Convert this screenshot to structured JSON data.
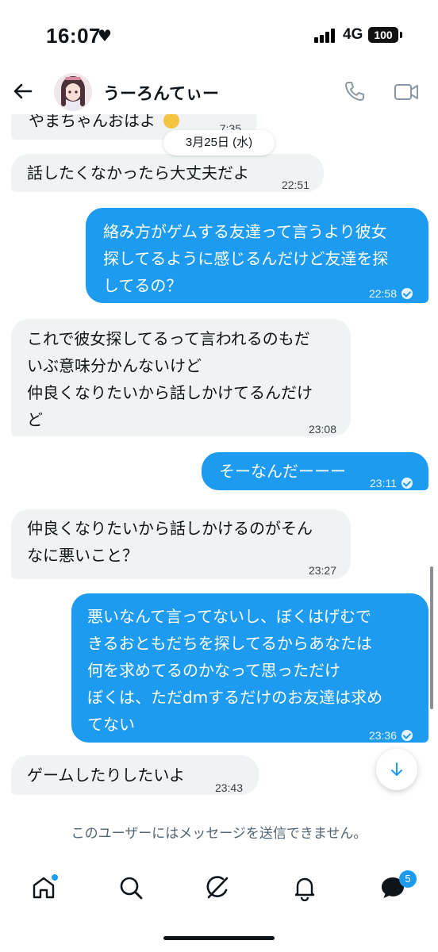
{
  "status_bar": {
    "time": "16:07",
    "heart": "♥",
    "network": "4G",
    "battery": "100"
  },
  "header": {
    "contact_name": "うーろんてぃー"
  },
  "chat": {
    "date_separator": "3月25日 (水)",
    "messages": [
      {
        "direction": "in",
        "text": "やまちゃんおはよ",
        "time": "7:35",
        "partial": true
      },
      {
        "direction": "in",
        "text": "話したくなかったら大丈夫だよ",
        "time": "22:51"
      },
      {
        "direction": "out",
        "text": "絡み方がゲムする友達って言うより彼女\n探してるように感じるんだけど友達を探\nしてるの？",
        "time": "22:58",
        "read": true
      },
      {
        "direction": "in",
        "text": "これで彼女探してるって言われるのもだ\nいぶ意味分かんないけど\n仲良くなりたいから話しかけてるんだけ\nど",
        "time": "23:08"
      },
      {
        "direction": "out",
        "text": "そーなんだーーー",
        "time": "23:11",
        "read": true
      },
      {
        "direction": "in",
        "text": "仲良くなりたいから話しかけるのがそん\nなに悪いこと？",
        "time": "23:27"
      },
      {
        "direction": "out",
        "text": "悪いなんて言ってないし、ぼくはげむで\nきるおともだちを探してるからあなたは\n何を求めてるのかなって思っただけ\nぼくは、ただdmするだけのお友達は求め\nてない",
        "time": "23:36",
        "read": true
      },
      {
        "direction": "in",
        "text": "ゲームしたりしたいよ",
        "time": "23:43"
      }
    ]
  },
  "notice": "このユーザーにはメッセージを送信できません。",
  "bottom_nav": {
    "messages_badge": "5"
  },
  "colors": {
    "accent": "#1d9bf0",
    "incoming_bubble": "#eff3f4",
    "text": "#0f1419",
    "muted": "#536471"
  },
  "icons": [
    "back-arrow-icon",
    "phone-icon",
    "video-icon",
    "home-icon",
    "search-icon",
    "grok-icon",
    "bell-icon",
    "messages-icon",
    "chevron-down-icon"
  ]
}
